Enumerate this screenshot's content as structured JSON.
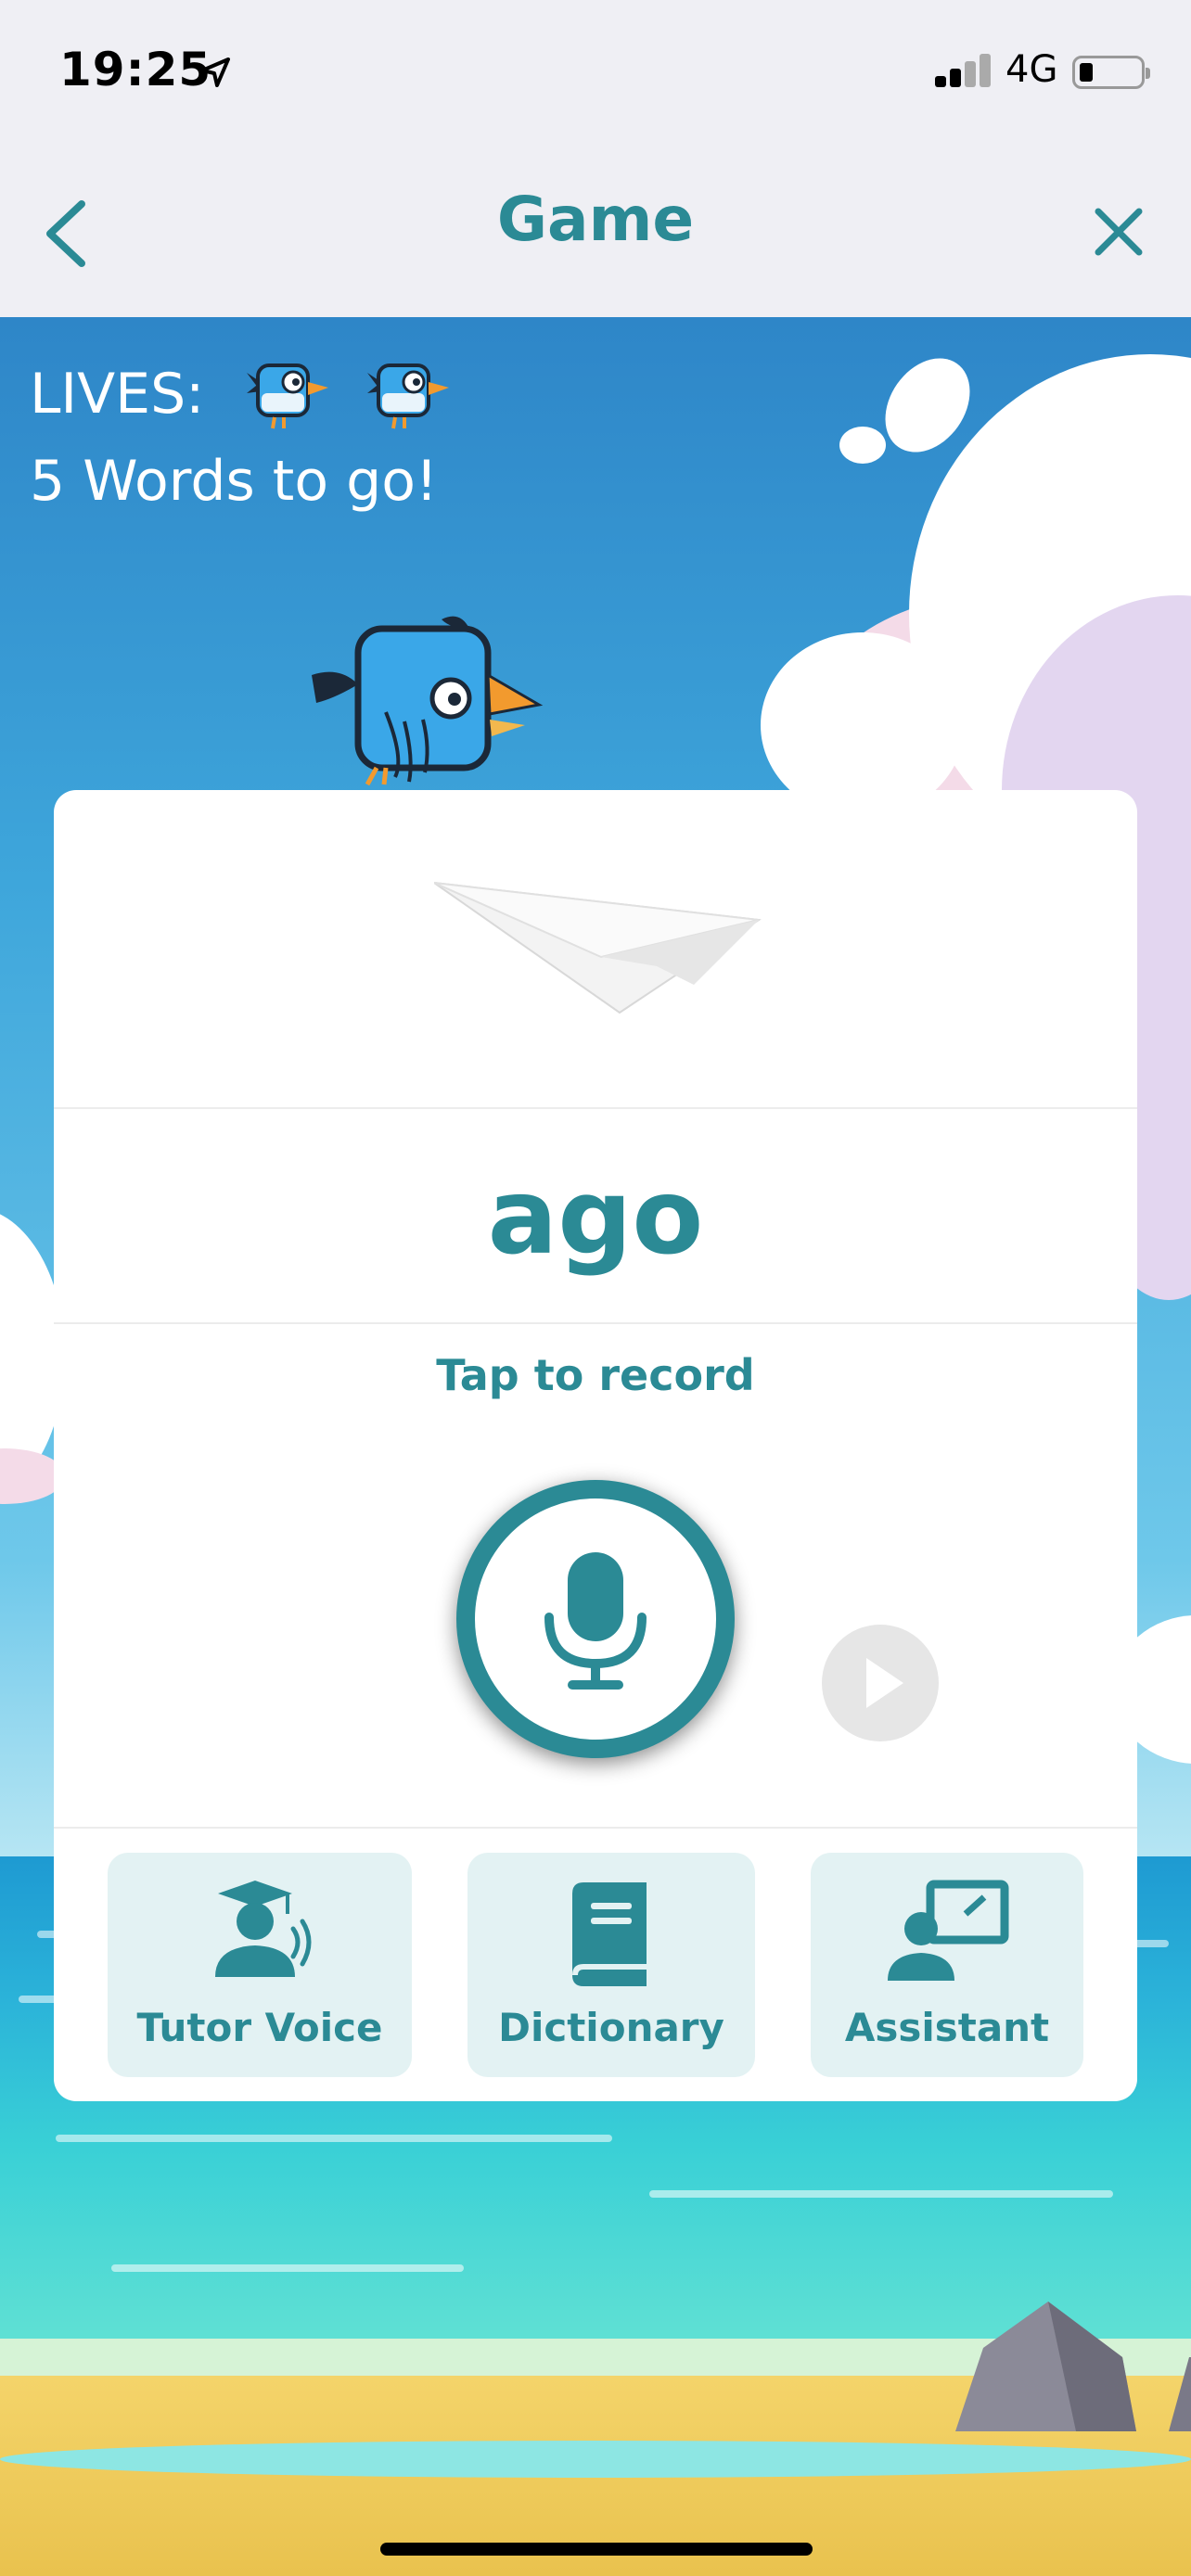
{
  "status_bar": {
    "time": "19:25",
    "network": "4G"
  },
  "nav": {
    "title": "Game"
  },
  "hud": {
    "lives_label": "LIVES:",
    "lives_count": 2,
    "words_remaining_text": "5 Words to go!"
  },
  "card": {
    "word": "ago",
    "record_hint": "Tap to record",
    "tools": [
      {
        "label": "Tutor Voice",
        "icon": "tutor-voice-icon"
      },
      {
        "label": "Dictionary",
        "icon": "dictionary-icon"
      },
      {
        "label": "Assistant",
        "icon": "assistant-icon"
      }
    ]
  },
  "colors": {
    "accent": "#2b8a95",
    "tool_bg": "#e3f2f3",
    "play_bg": "#e6e6e6"
  }
}
